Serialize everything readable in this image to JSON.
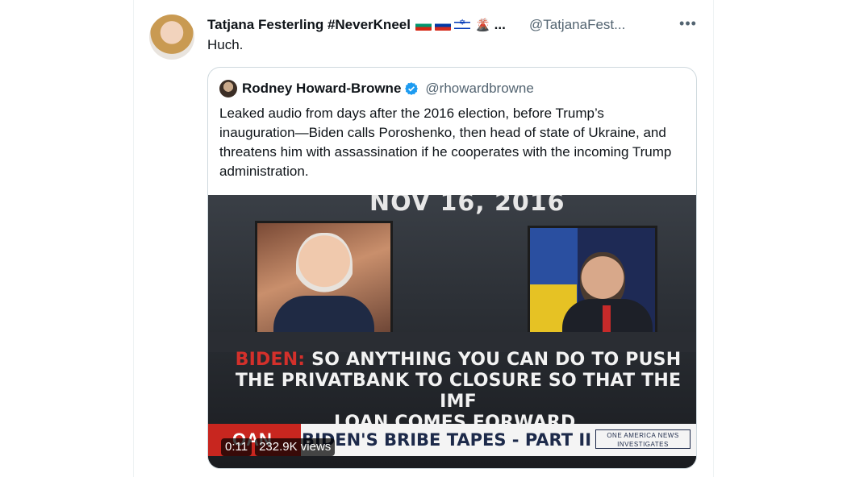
{
  "tweet": {
    "display_name": "Tatjana Festerling #NeverKneel",
    "name_suffix": "...",
    "handle": "@TatjanaFest...",
    "text": "Huch.",
    "icons": [
      "bulgaria-flag-icon",
      "russia-flag-icon",
      "israel-flag-icon",
      "volcano-icon",
      "more-icon"
    ]
  },
  "quote": {
    "display_name": "Rodney Howard-Browne",
    "handle": "@rhowardbrowne",
    "text": "Leaked audio from days after the 2016 election, before Trump’s inauguration—Biden calls Poroshenko, then head of state of Ukraine, and threatens him with assassination if he cooperates with the incoming Trump administration.",
    "verified_color": "#1d9bf0"
  },
  "video": {
    "date_text": "NOV 16, 2016",
    "caption_speaker": "BIDEN:",
    "caption_line1": "SO ANYTHING YOU CAN DO TO PUSH",
    "caption_line2": "THE PRIVATBANK TO CLOSURE SO THAT THE IMF",
    "caption_line3": "LOAN COMES FORWARD,",
    "network_logo": "OAN",
    "headline": "BIDEN'S BRIBE TAPES - PART II",
    "badge": "ONE AMERICA NEWS INVESTIGATES",
    "time": "0:11",
    "views": "232.9K views"
  }
}
